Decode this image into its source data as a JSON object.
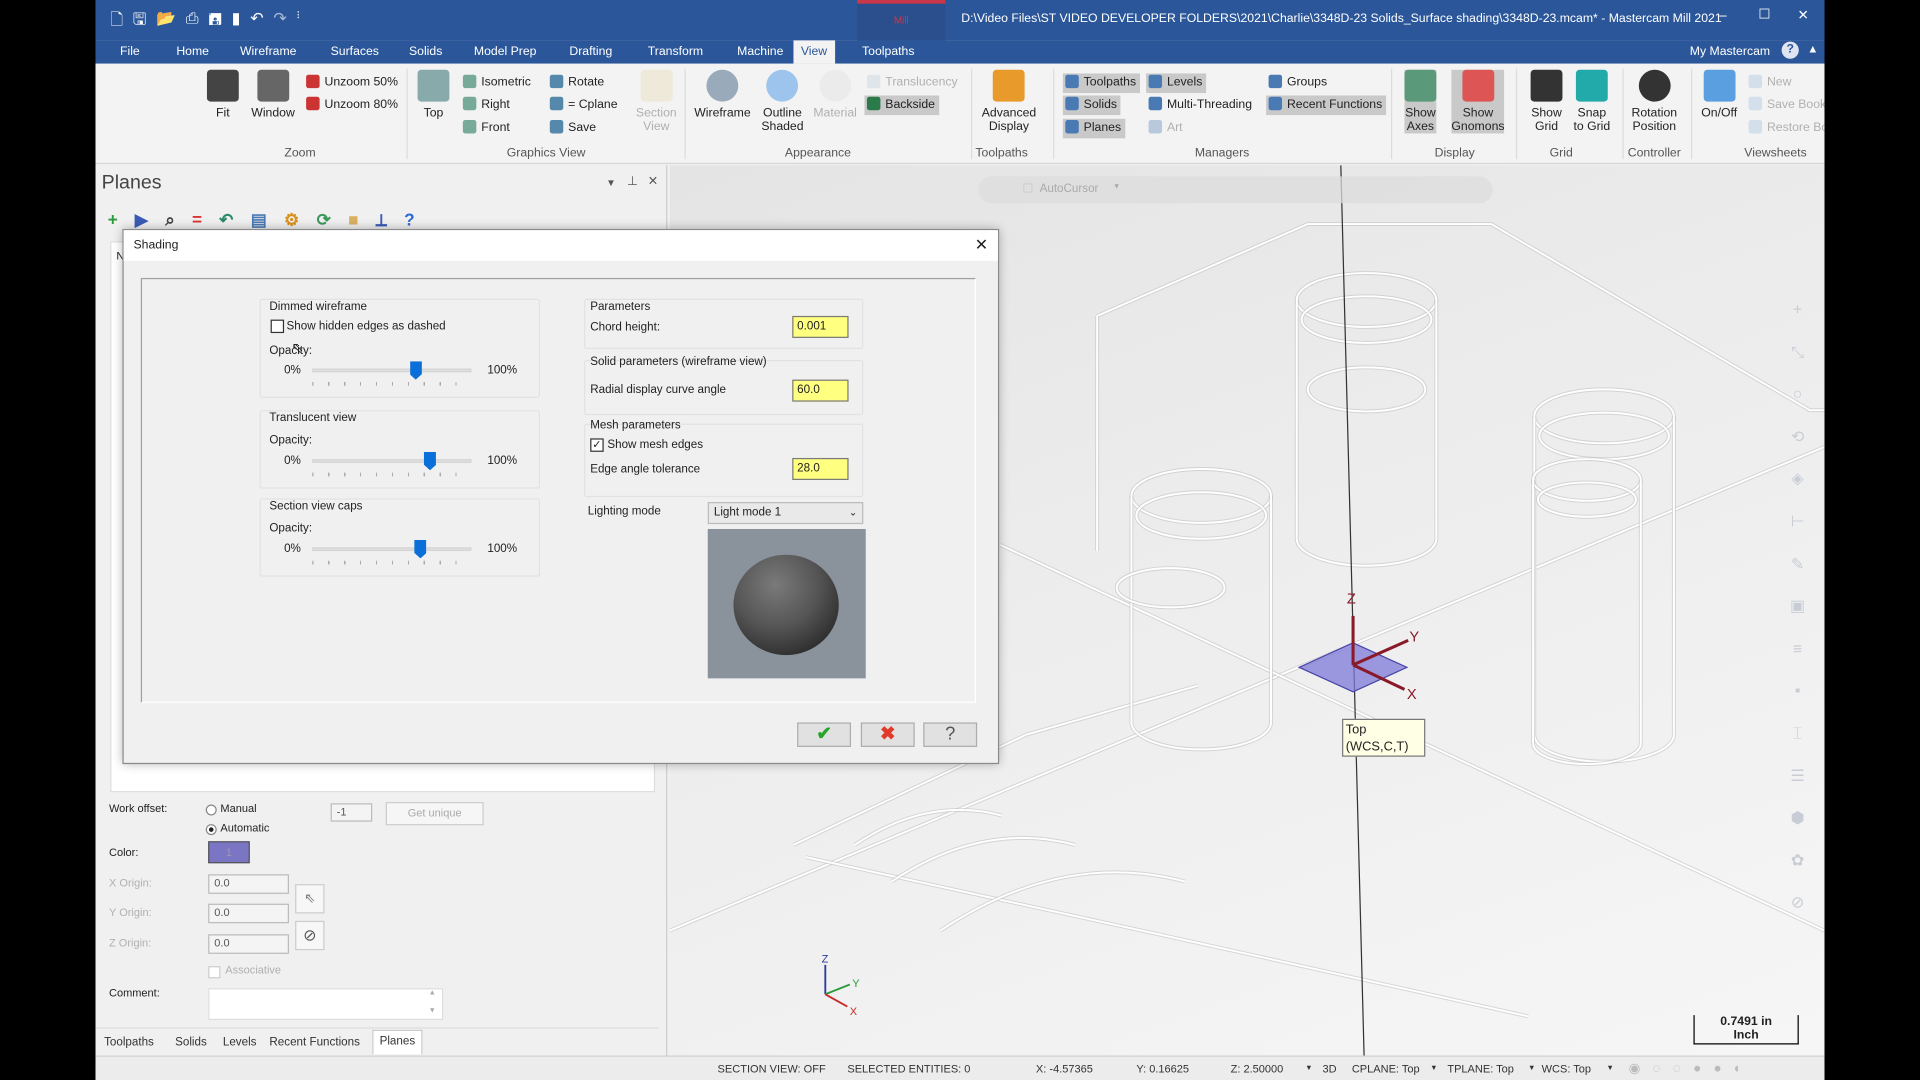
{
  "title_bar": {
    "mode": "Mill",
    "title": "D:\\Video Files\\ST VIDEO DEVELOPER FOLDERS\\2021\\Charlie\\3348D-23 Solids_Surface shading\\3348D-23.mcam* - Mastercam Mill 2021",
    "quick_access": [
      "new-icon",
      "save-icon",
      "open-icon",
      "print-icon",
      "save-as-icon",
      "merge-icon",
      "undo-icon",
      "redo-icon",
      "customize-icon"
    ],
    "controls": {
      "minimize": "–",
      "maximize": "☐",
      "close": "✕"
    },
    "accent": "#2b579a"
  },
  "tabs": [
    "File",
    "Home",
    "Wireframe",
    "Surfaces",
    "Solids",
    "Model Prep",
    "Drafting",
    "Transform",
    "Machine",
    "View",
    "Toolpaths"
  ],
  "active_tab": "View",
  "my_mastercam": "My Mastercam",
  "ribbon": {
    "groups": [
      {
        "label": "Zoom",
        "items": [
          {
            "label": "Fit",
            "icon": "fit-icon"
          },
          {
            "label": "Window",
            "icon": "zoom-window-icon"
          },
          {
            "label": "Unzoom 50%",
            "icon": "unzoom-icon"
          },
          {
            "label": "Unzoom 80%",
            "icon": "unzoom-icon"
          }
        ]
      },
      {
        "label": "Graphics View",
        "items": [
          {
            "label": "Top",
            "icon": "top-view-icon"
          },
          {
            "label": "Isometric",
            "icon": "isometric-icon"
          },
          {
            "label": "Right",
            "icon": "right-view-icon"
          },
          {
            "label": "Front",
            "icon": "front-view-icon"
          },
          {
            "label": "Rotate",
            "icon": "rotate-icon"
          },
          {
            "label": "= Cplane",
            "icon": "cplane-icon"
          },
          {
            "label": "Save",
            "icon": "save-view-icon"
          },
          {
            "label": "Section\nView",
            "icon": "section-view-icon"
          }
        ]
      },
      {
        "label": "Appearance",
        "items": [
          {
            "label": "Wireframe",
            "icon": "wireframe-icon"
          },
          {
            "label": "Outline\nShaded",
            "icon": "outline-shaded-icon"
          },
          {
            "label": "Material",
            "icon": "material-icon"
          },
          {
            "label": "Translucency",
            "icon": "translucency-icon"
          },
          {
            "label": "Backside",
            "icon": "backside-icon"
          }
        ]
      },
      {
        "label": "Toolpaths",
        "items": [
          {
            "label": "Advanced\nDisplay",
            "icon": "advanced-display-icon"
          }
        ]
      },
      {
        "label": "Managers",
        "items": [
          {
            "label": "Toolpaths",
            "icon": "manager-icon"
          },
          {
            "label": "Solids",
            "icon": "manager-icon"
          },
          {
            "label": "Planes",
            "icon": "manager-icon"
          },
          {
            "label": "Levels",
            "icon": "manager-icon"
          },
          {
            "label": "Multi-Threading",
            "icon": "manager-icon"
          },
          {
            "label": "Art",
            "icon": "manager-icon"
          },
          {
            "label": "Groups",
            "icon": "manager-icon"
          },
          {
            "label": "Recent Functions",
            "icon": "manager-icon"
          }
        ]
      },
      {
        "label": "Display",
        "items": [
          {
            "label": "Show\nAxes",
            "icon": "axes-icon"
          },
          {
            "label": "Show\nGnomons",
            "icon": "gnomon-icon"
          }
        ]
      },
      {
        "label": "Grid",
        "items": [
          {
            "label": "Show\nGrid",
            "icon": "grid-icon"
          },
          {
            "label": "Snap\nto Grid",
            "icon": "snap-grid-icon"
          }
        ]
      },
      {
        "label": "Controller",
        "items": [
          {
            "label": "Rotation\nPosition",
            "icon": "rotation-position-icon"
          }
        ]
      },
      {
        "label": "Viewsheets",
        "items": [
          {
            "label": "On/Off",
            "icon": "viewsheet-icon"
          },
          {
            "label": "New",
            "icon": "new-viewsheet-icon"
          },
          {
            "label": "Save Bookmark",
            "icon": "bookmark-icon"
          },
          {
            "label": "Restore Bookmark",
            "icon": "restore-bookmark-icon"
          }
        ]
      }
    ]
  },
  "planes_panel": {
    "title": "Planes",
    "column_header": "N",
    "toolbar": [
      "add-plane-icon",
      "select-entity-icon",
      "find-icon",
      "equal-icon",
      "undo-arrow-icon",
      "properties-icon",
      "settings-gear-icon",
      "refresh-icon",
      "box-icon",
      "gnomon-icon",
      "help-icon"
    ],
    "form": {
      "work_offset_label": "Work offset:",
      "manual": "Manual",
      "automatic": "Automatic",
      "work_offset_selected": "Automatic",
      "work_offset_value": "-1",
      "get_unique": "Get unique",
      "color_label": "Color:",
      "color_value": "1",
      "color_swatch": "#7b76c4",
      "x_origin_label": "X Origin:",
      "x_origin": "0.0",
      "y_origin_label": "Y Origin:",
      "y_origin": "0.0",
      "z_origin_label": "Z Origin:",
      "z_origin": "0.0",
      "associative": "Associative",
      "associative_checked": false,
      "comment_label": "Comment:",
      "comment": ""
    },
    "tabs": [
      "Toolpaths",
      "Solids",
      "Levels",
      "Recent Functions",
      "Planes"
    ],
    "active_tab": "Planes"
  },
  "dialog": {
    "title": "Shading",
    "dimmed_wireframe": {
      "title": "Dimmed wireframe",
      "show_hidden_dashed": "Show hidden edges as dashed",
      "show_hidden_checked": false,
      "opacity_label": "Opacity:",
      "min": "0%",
      "max": "100%",
      "opacity": 0.65
    },
    "translucent_view": {
      "title": "Translucent view",
      "opacity_label": "Opacity:",
      "min": "0%",
      "max": "100%",
      "opacity": 0.74
    },
    "section_view_caps": {
      "title": "Section view caps",
      "opacity_label": "Opacity:",
      "min": "0%",
      "max": "100%",
      "opacity": 0.68
    },
    "parameters": {
      "title": "Parameters",
      "chord_height_label": "Chord height:",
      "chord_height": "0.001"
    },
    "solid_parameters": {
      "title": "Solid parameters (wireframe view)",
      "radial_label": "Radial display curve angle",
      "radial": "60.0"
    },
    "mesh_parameters": {
      "title": "Mesh parameters",
      "show_mesh_edges": "Show mesh edges",
      "show_mesh_checked": true,
      "edge_angle_label": "Edge angle tolerance",
      "edge_angle": "28.0"
    },
    "lighting_mode_label": "Lighting mode",
    "lighting_mode": "Light mode 1",
    "input_highlight": "#ffff80",
    "ok_icon": "checkmark-icon",
    "cancel_icon": "x-icon",
    "help_icon": "question-icon"
  },
  "viewport": {
    "autocursor": "AutoCursor",
    "view_tooltip": [
      "Top",
      "(WCS,C,T)"
    ],
    "gnomon_labels": {
      "x": "X",
      "y": "Y",
      "z": "Z"
    },
    "triad_labels": {
      "x": "X",
      "y": "Y",
      "z": "Z"
    },
    "scale_value": "0.7491 in",
    "scale_unit": "Inch"
  },
  "status_bar": {
    "section_view": "SECTION VIEW: OFF",
    "selected": "SELECTED ENTITIES: 0",
    "x": "X:  -4.57365",
    "y": "Y:  0.16625",
    "z": "Z:  2.50000",
    "mode": "3D",
    "cplane": "CPLANE: Top",
    "tplane": "TPLANE: Top",
    "wcs": "WCS: Top"
  }
}
